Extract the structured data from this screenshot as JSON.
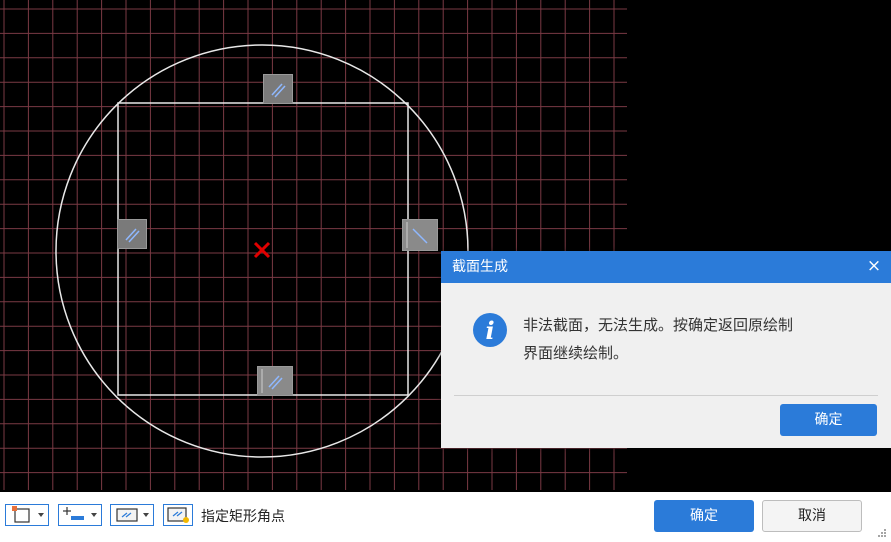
{
  "canvas": {
    "grid_color": "#7a3a44",
    "shape_color": "#e8e8e8",
    "center_marker_color": "#e00000",
    "icons": {
      "handle": "edit-handle-icon",
      "center": "center-cross-icon"
    }
  },
  "dialog": {
    "title": "截面生成",
    "close_label": "×",
    "message_line1": "非法截面，无法生成。按确定返回原绘制",
    "message_line2": "界面继续绘制。",
    "ok_label": "确定",
    "accent_color": "#2b7bd9",
    "icon": "info-icon"
  },
  "toolbar": {
    "tools": [
      {
        "name": "rectangle-tool",
        "icon": "rectangle-icon",
        "has_dropdown": true
      },
      {
        "name": "snap-tool",
        "icon": "point-snap-icon",
        "has_dropdown": true
      },
      {
        "name": "dimension-tool",
        "icon": "dimension-icon",
        "has_dropdown": true
      },
      {
        "name": "property-tool",
        "icon": "property-edit-icon",
        "has_dropdown": false
      }
    ],
    "hint": "指定矩形角点",
    "ok_label": "确定",
    "cancel_label": "取消"
  }
}
